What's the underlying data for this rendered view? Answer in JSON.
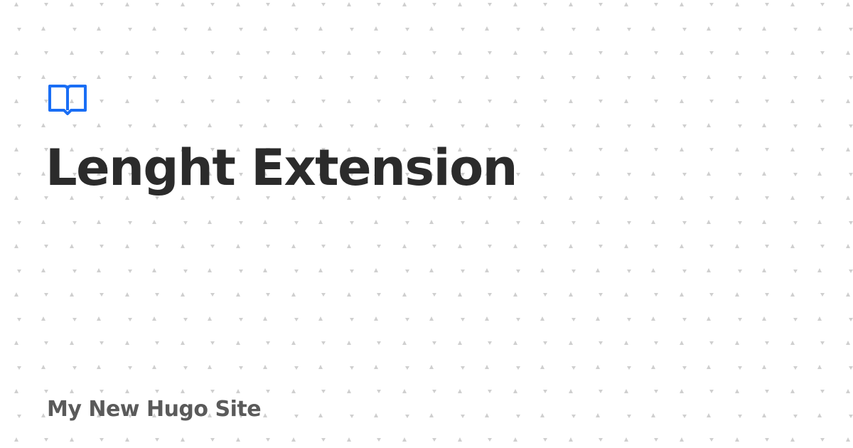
{
  "page": {
    "title": "Lenght Extension",
    "site_name": "My New Hugo Site"
  },
  "logo": {
    "icon": "open-book-icon",
    "color": "#1a6ef5"
  },
  "colors": {
    "background": "#ffffff",
    "title": "#2b2b2b",
    "site_name": "#5a5a5a",
    "pattern_dot": "#cfcfcf"
  }
}
